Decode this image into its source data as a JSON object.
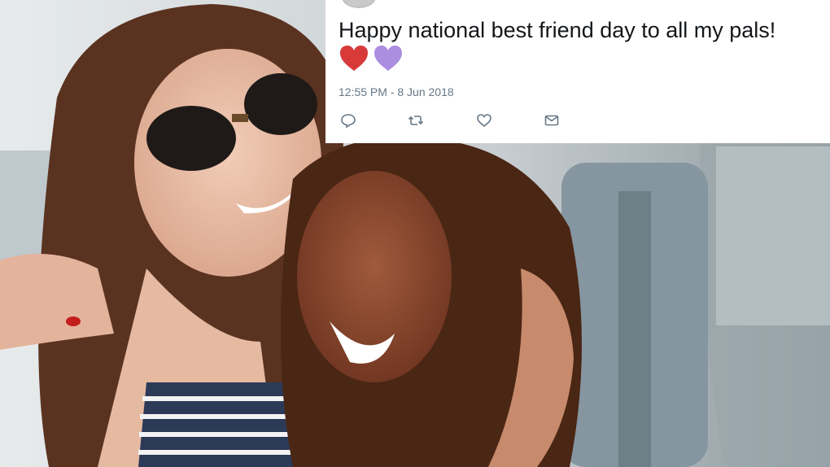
{
  "tweet": {
    "text": "Happy national best friend day to all my pals!",
    "emoji": [
      "red-heart",
      "purple-heart"
    ],
    "timestamp": "12:55 PM - 8 Jun 2018",
    "actions": [
      "reply-icon",
      "retweet-icon",
      "like-icon",
      "direct-message-icon"
    ]
  },
  "colors": {
    "card_background": "#ffffff",
    "text": "#14171a",
    "meta": "#657786",
    "red_heart": "#d83a3a",
    "purple_heart": "#ac8ee0"
  }
}
